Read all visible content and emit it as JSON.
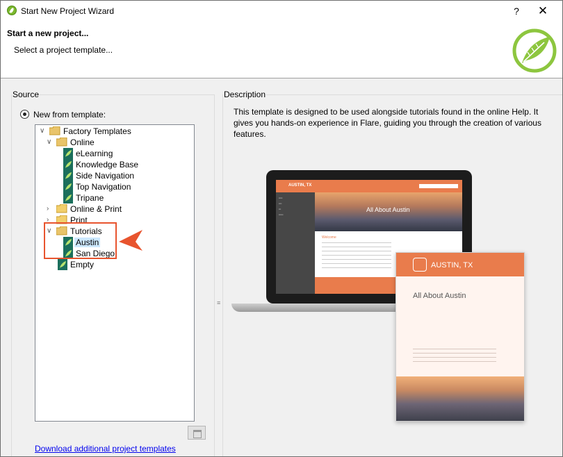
{
  "window": {
    "title": "Start New Project Wizard",
    "help_label": "?",
    "close_label": "✕"
  },
  "header": {
    "title": "Start a new project...",
    "subtitle": "Select a project template..."
  },
  "source": {
    "group_label": "Source",
    "radio_label": "New from template:",
    "tree": {
      "factory": "Factory Templates",
      "online": "Online",
      "elearning": "eLearning",
      "knowledge_base": "Knowledge Base",
      "side_navigation": "Side Navigation",
      "top_navigation": "Top Navigation",
      "tripane": "Tripane",
      "online_print": "Online & Print",
      "print": "Print",
      "tutorials": "Tutorials",
      "austin": "Austin",
      "san_diego": "San Diego",
      "empty": "Empty"
    },
    "download_link": "Download additional project templates"
  },
  "description": {
    "group_label": "Description",
    "text": "This template is designed to be used alongside tutorials found in the online Help. It gives you hands-on experience in Flare, guiding you through the creation of various features.",
    "preview": {
      "laptop_brand": "AUSTIN, TX",
      "laptop_hero": "All About Austin",
      "laptop_welcome": "Welcome",
      "tablet_brand": "AUSTIN, TX",
      "tablet_title": "All About Austin"
    }
  },
  "colors": {
    "accent_orange": "#e97c4c",
    "flare_green": "#8dc63f",
    "selection": "#cce8ff",
    "link": "#0000ee"
  }
}
